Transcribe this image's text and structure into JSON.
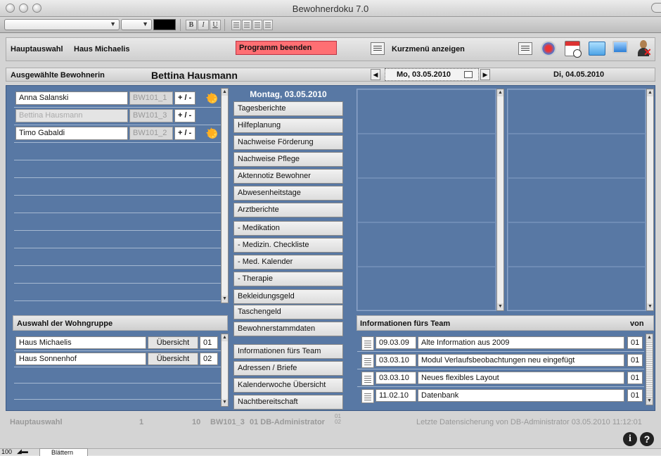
{
  "window": {
    "title": "Bewohnerdoku 7.0"
  },
  "format_toolbar": {
    "bold": "B",
    "italic": "I",
    "underline": "U"
  },
  "header": {
    "hauptauswahl_label": "Hauptauswahl",
    "haus_name": "Haus Michaelis",
    "quit_button": "Programm beenden",
    "short_menu_button": "Kurzmenü anzeigen"
  },
  "resident_bar": {
    "label": "Ausgewählte Bewohnerin",
    "name": "Bettina Hausmann",
    "date_current": "Mo, 03.05.2010",
    "date_next": "Di, 04.05.2010"
  },
  "residents": [
    {
      "name": "Anna Salanski",
      "code": "BW101_1",
      "toggle": "+ / -",
      "active": true
    },
    {
      "name": "Bettina Hausmann",
      "code": "BW101_3",
      "toggle": "+ / -",
      "active": false
    },
    {
      "name": "Timo Gabaldi",
      "code": "BW101_2",
      "toggle": "+ / -",
      "active": true
    }
  ],
  "day_heading": "Montag, 03.05.2010",
  "menu": [
    "Tagesberichte",
    "Hilfeplanung",
    "Nachweise Förderung",
    "Nachweise Pflege",
    "Aktennotiz Bewohner",
    "Abwesenheitstage",
    "Arztberichte",
    "- Medikation",
    "- Medizin. Checkliste",
    "- Med. Kalender",
    "- Therapie",
    "Bekleidungsgeld",
    "Taschengeld",
    "Bewohnerstammdaten"
  ],
  "menu_lower": [
    "Informationen fürs Team",
    "Adressen / Briefe",
    "Kalenderwoche Übersicht",
    "Nachtbereitschaft"
  ],
  "wohngruppe": {
    "title": "Auswahl der Wohngruppe",
    "items": [
      {
        "name": "Haus Michaelis",
        "button": "Übersicht",
        "num": "01"
      },
      {
        "name": "Haus Sonnenhof",
        "button": "Übersicht",
        "num": "02"
      }
    ]
  },
  "team_info": {
    "title": "Informationen fürs Team",
    "von": "von",
    "items": [
      {
        "date": "09.03.09",
        "text": "Alte Information aus 2009",
        "num": "01"
      },
      {
        "date": "03.03.10",
        "text": "Modul Verlaufsbeobachtungen neu eingefügt",
        "num": "01"
      },
      {
        "date": "03.03.10",
        "text": "Neues flexibles Layout",
        "num": "01"
      },
      {
        "date": "11.02.10",
        "text": "Datenbank",
        "num": "01"
      }
    ]
  },
  "status_bar": {
    "label": "Hauptauswahl",
    "n1": "1",
    "n2": "10",
    "code": "BW101_3",
    "user": "01 DB-Administrator",
    "vertical": "01 02",
    "backup": "Letzte Datensicherung von DB-Administrator 03.05.2010 11:12:01"
  },
  "bottom": {
    "zoom": "100",
    "mode": "Blättern"
  },
  "colors": {
    "panel": "#5878a4",
    "quit": "#ff6f73"
  }
}
